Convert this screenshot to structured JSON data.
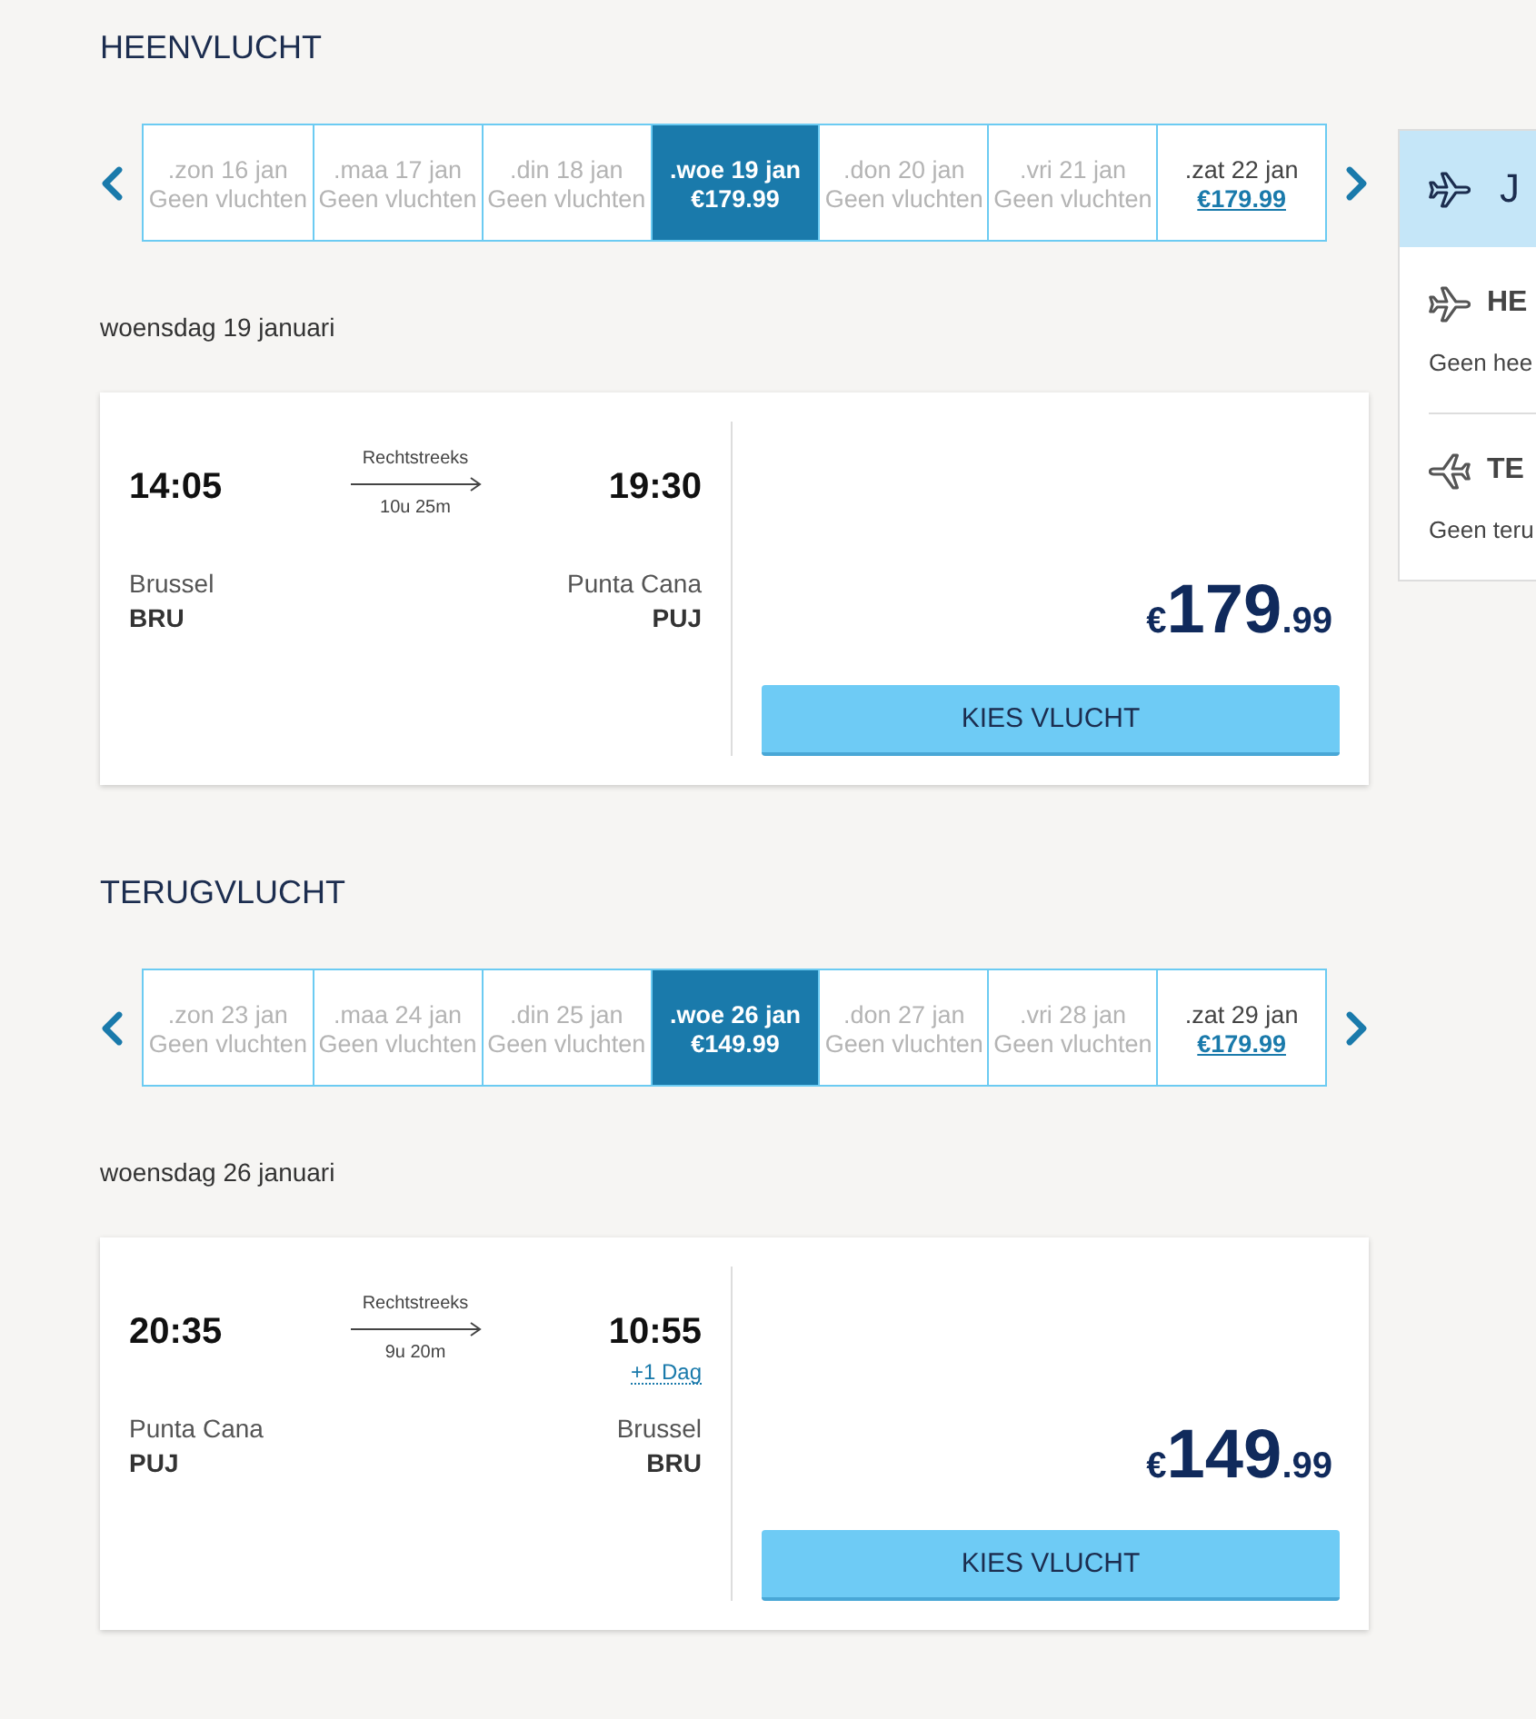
{
  "journeys": [
    {
      "title": "HEENVLUCHT",
      "days": [
        {
          "date": ".zon 16 jan",
          "info": "Geen vluchten",
          "available": false,
          "selected": false
        },
        {
          "date": ".maa 17 jan",
          "info": "Geen vluchten",
          "available": false,
          "selected": false
        },
        {
          "date": ".din 18 jan",
          "info": "Geen vluchten",
          "available": false,
          "selected": false
        },
        {
          "date": ".woe 19 jan",
          "info": "€179.99",
          "available": true,
          "selected": true
        },
        {
          "date": ".don 20 jan",
          "info": "Geen vluchten",
          "available": false,
          "selected": false
        },
        {
          "date": ".vri 21 jan",
          "info": "Geen vluchten",
          "available": false,
          "selected": false
        },
        {
          "date": ".zat 22 jan",
          "info": "€179.99",
          "available": true,
          "selected": false
        }
      ],
      "date_heading": "woensdag 19 januari",
      "flight": {
        "departure_time": "14:05",
        "route": "Rechtstreeks",
        "duration": "10u 25m",
        "arrival_time": "19:30",
        "departure_city": "Brussel",
        "departure_code": "BRU",
        "arrival_city": "Punta Cana",
        "arrival_code": "PUJ",
        "price": {
          "currency": "€",
          "amount": "179",
          "cents": ".99"
        },
        "button": "KIES VLUCHT"
      }
    },
    {
      "title": "TERUGVLUCHT",
      "days": [
        {
          "date": ".zon 23 jan",
          "info": "Geen vluchten",
          "available": false,
          "selected": false
        },
        {
          "date": ".maa 24 jan",
          "info": "Geen vluchten",
          "available": false,
          "selected": false
        },
        {
          "date": ".din 25 jan",
          "info": "Geen vluchten",
          "available": false,
          "selected": false
        },
        {
          "date": ".woe 26 jan",
          "info": "€149.99",
          "available": true,
          "selected": true
        },
        {
          "date": ".don 27 jan",
          "info": "Geen vluchten",
          "available": false,
          "selected": false
        },
        {
          "date": ".vri 28 jan",
          "info": "Geen vluchten",
          "available": false,
          "selected": false
        },
        {
          "date": ".zat 29 jan",
          "info": "€179.99",
          "available": true,
          "selected": false
        }
      ],
      "date_heading": "woensdag 26 januari",
      "flight": {
        "departure_time": "20:35",
        "route": "Rechtstreeks",
        "duration": "9u 20m",
        "arrival_time": "10:55",
        "arrival_note": "+1 Dag",
        "departure_city": "Punta Cana",
        "departure_code": "PUJ",
        "arrival_city": "Brussel",
        "arrival_code": "BRU",
        "price": {
          "currency": "€",
          "amount": "149",
          "cents": ".99"
        },
        "button": "KIES VLUCHT"
      }
    }
  ],
  "summary": {
    "title": "J",
    "sections": [
      {
        "kind": "outbound",
        "title": "HE",
        "text": "Geen hee"
      },
      {
        "kind": "return",
        "title": "TE",
        "text": "Geen teru"
      }
    ]
  }
}
